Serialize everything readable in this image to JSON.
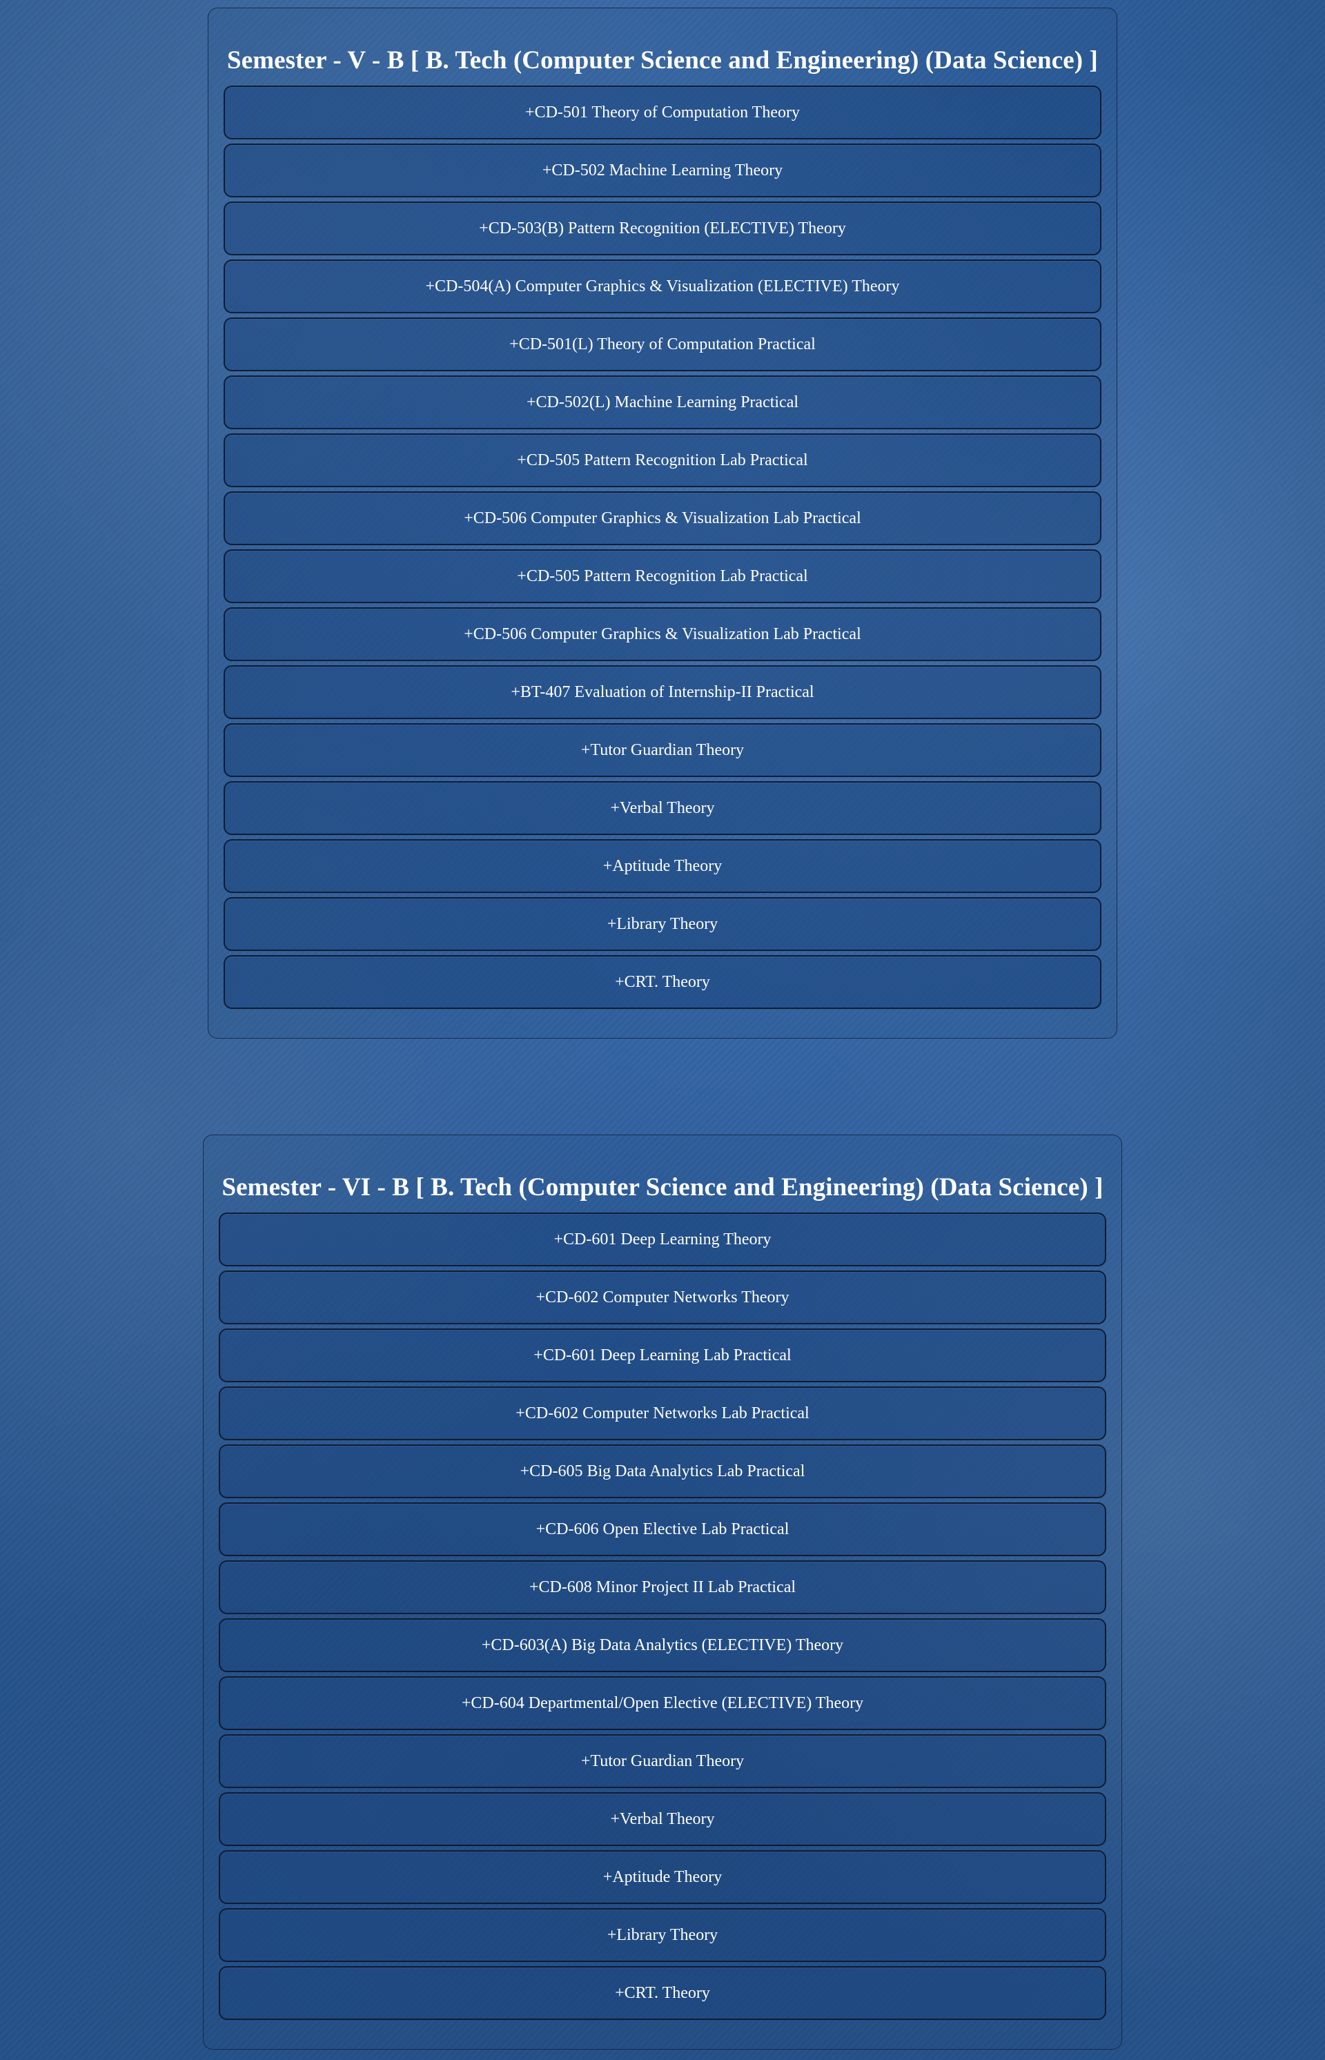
{
  "colors": {
    "background": "#2f5f9e",
    "text": "#ffffff",
    "item_background": "#1c467d",
    "border": "#0a1428"
  },
  "semesters": [
    {
      "title": "Semester - V - B [ B. Tech (Computer Science and Engineering) (Data Science) ]",
      "items": [
        {
          "label": "+CD-501 Theory of Computation Theory"
        },
        {
          "label": "+CD-502 Machine Learning Theory"
        },
        {
          "label": "+CD-503(B) Pattern Recognition (ELECTIVE) Theory"
        },
        {
          "label": "+CD-504(A) Computer Graphics & Visualization (ELECTIVE) Theory"
        },
        {
          "label": "+CD-501(L) Theory of Computation Practical"
        },
        {
          "label": "+CD-502(L) Machine Learning Practical"
        },
        {
          "label": "+CD-505 Pattern Recognition Lab Practical"
        },
        {
          "label": "+CD-506 Computer Graphics & Visualization Lab Practical"
        },
        {
          "label": "+CD-505 Pattern Recognition Lab Practical"
        },
        {
          "label": "+CD-506 Computer Graphics & Visualization Lab Practical"
        },
        {
          "label": "+BT-407 Evaluation of Internship-II Practical"
        },
        {
          "label": "+Tutor Guardian Theory"
        },
        {
          "label": "+Verbal Theory"
        },
        {
          "label": "+Aptitude Theory"
        },
        {
          "label": "+Library Theory"
        },
        {
          "label": "+CRT. Theory"
        }
      ]
    },
    {
      "title": "Semester - VI - B [ B. Tech (Computer Science and Engineering) (Data Science) ]",
      "items": [
        {
          "label": "+CD-601 Deep Learning Theory"
        },
        {
          "label": "+CD-602 Computer Networks Theory"
        },
        {
          "label": "+CD-601 Deep Learning Lab Practical"
        },
        {
          "label": "+CD-602 Computer Networks Lab Practical"
        },
        {
          "label": "+CD-605 Big Data Analytics Lab Practical"
        },
        {
          "label": "+CD-606 Open Elective Lab Practical"
        },
        {
          "label": "+CD-608 Minor Project II Lab Practical"
        },
        {
          "label": "+CD-603(A) Big Data Analytics (ELECTIVE) Theory"
        },
        {
          "label": "+CD-604 Departmental/Open Elective (ELECTIVE) Theory"
        },
        {
          "label": "+Tutor Guardian Theory"
        },
        {
          "label": "+Verbal Theory"
        },
        {
          "label": "+Aptitude Theory"
        },
        {
          "label": "+Library Theory"
        },
        {
          "label": "+CRT. Theory"
        }
      ]
    }
  ]
}
